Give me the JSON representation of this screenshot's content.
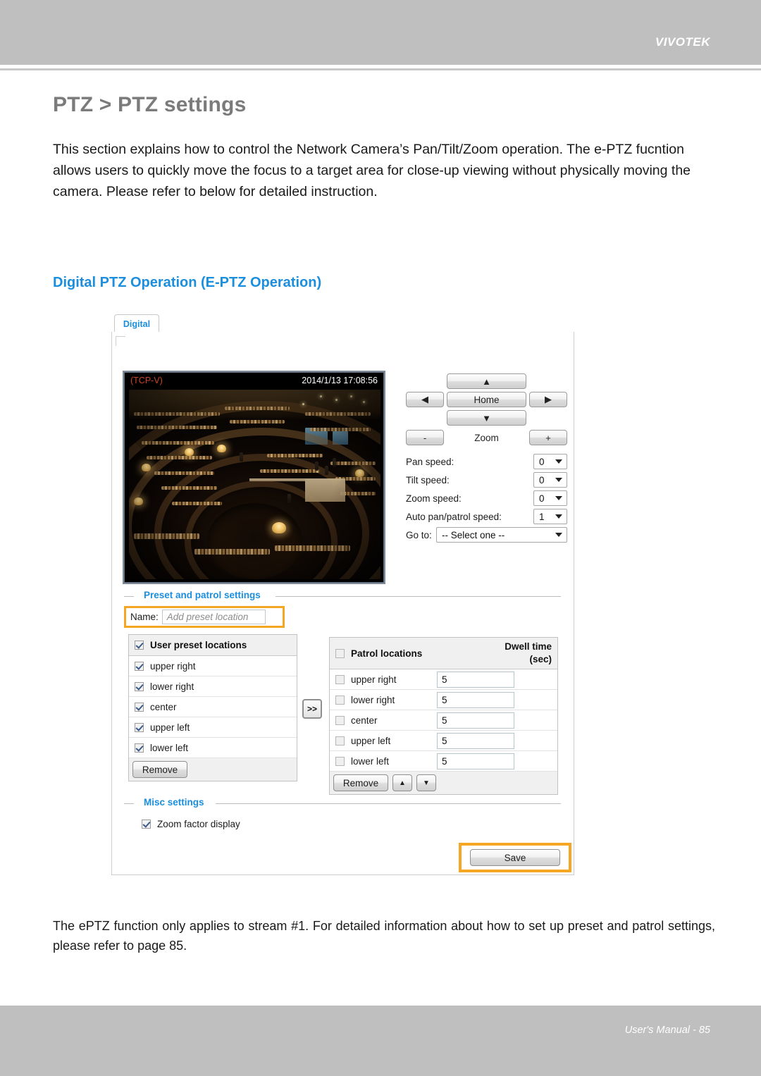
{
  "header": {
    "brand": "VIVOTEK"
  },
  "page": {
    "title": "PTZ > PTZ settings",
    "intro": "This section explains how to control the Network Camera’s Pan/Tilt/Zoom operation. The e-PTZ fucntion allows users to quickly move the focus to a target area for close-up viewing without physically moving the camera. Please refer to below for detailed instruction.",
    "section_title": "Digital PTZ Operation (E-PTZ Operation)",
    "note": "The ePTZ function only applies to stream #1. For detailed information about how to set up preset and patrol settings, please refer to page 85."
  },
  "tab": {
    "label": "Digital"
  },
  "video": {
    "osd_left": "(TCP-V)",
    "osd_date": "2014/1/13",
    "osd_time": "17:08:56",
    "osd_right": "2014/1/13  17:08:56"
  },
  "ptz": {
    "up_label": "▲",
    "left_label": "◀",
    "home_label": "Home",
    "right_label": "▶",
    "down_label": "▼",
    "zoom_minus_label": "-",
    "zoom_label": "Zoom",
    "zoom_plus_label": "+",
    "pan_speed_label": "Pan speed:",
    "pan_speed_value": "0",
    "tilt_speed_label": "Tilt speed:",
    "tilt_speed_value": "0",
    "zoom_speed_label": "Zoom speed:",
    "zoom_speed_value": "0",
    "auto_pan_label": "Auto pan/patrol speed:",
    "auto_pan_value": "1",
    "goto_label": "Go to:",
    "goto_value": "-- Select one --"
  },
  "preset": {
    "legend": "Preset and patrol settings",
    "name_label": "Name:",
    "name_placeholder": "Add preset location",
    "transfer_label": ">>",
    "user_list_header": "User preset locations",
    "user_items": [
      "upper right",
      "lower right",
      "center",
      "upper left",
      "lower left"
    ],
    "user_remove_label": "Remove",
    "patrol_list_header": "Patrol locations",
    "dwell_header_line1": "Dwell time",
    "dwell_header_line2": "(sec)",
    "patrol_items": [
      {
        "label": "upper right",
        "dwell": "5"
      },
      {
        "label": "lower right",
        "dwell": "5"
      },
      {
        "label": "center",
        "dwell": "5"
      },
      {
        "label": "upper left",
        "dwell": "5"
      },
      {
        "label": "lower left",
        "dwell": "5"
      }
    ],
    "patrol_remove_label": "Remove",
    "patrol_up_label": "▲",
    "patrol_down_label": "▼"
  },
  "misc": {
    "legend": "Misc settings",
    "zoom_factor_label": "Zoom factor display"
  },
  "actions": {
    "save_label": "Save"
  },
  "footer": {
    "text": "User's Manual - 85"
  },
  "colors": {
    "accent_blue": "#1b8ede",
    "highlight_orange": "#f5a623",
    "header_gray": "#bfbfbf",
    "title_gray": "#7b7b7b"
  }
}
